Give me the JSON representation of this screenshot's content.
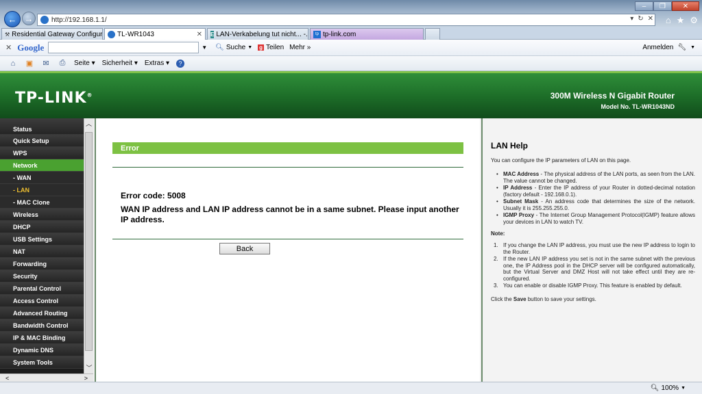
{
  "browser": {
    "address": "http://192.168.1.1/",
    "tabs": [
      {
        "label": "Residential Gateway Configura...",
        "active": false
      },
      {
        "label": "TL-WR1043",
        "active": true
      },
      {
        "label": "LAN-Verkabelung tut nicht... -...",
        "active": false
      },
      {
        "label": "tp-link.com",
        "active": false
      }
    ],
    "google_logo": "Google",
    "google_items": {
      "search": "Suche",
      "translate": "Teilen",
      "more": "Mehr »",
      "signin": "Anmelden"
    },
    "command_items": {
      "page": "Seite",
      "safety": "Sicherheit",
      "tools": "Extras"
    },
    "zoom": "100%"
  },
  "router": {
    "logo": "TP-LINK",
    "product": "300M Wireless N Gigabit Router",
    "model": "Model No. TL-WR1043ND",
    "menu": [
      {
        "label": "Status"
      },
      {
        "label": "Quick Setup"
      },
      {
        "label": "WPS"
      },
      {
        "label": "Network"
      },
      {
        "label": "- WAN"
      },
      {
        "label": "- LAN"
      },
      {
        "label": "- MAC Clone"
      },
      {
        "label": "Wireless"
      },
      {
        "label": "DHCP"
      },
      {
        "label": "USB Settings"
      },
      {
        "label": "NAT"
      },
      {
        "label": "Forwarding"
      },
      {
        "label": "Security"
      },
      {
        "label": "Parental Control"
      },
      {
        "label": "Access Control"
      },
      {
        "label": "Advanced Routing"
      },
      {
        "label": "Bandwidth Control"
      },
      {
        "label": "IP & MAC Binding"
      },
      {
        "label": "Dynamic DNS"
      },
      {
        "label": "System Tools"
      }
    ],
    "error": {
      "title": "Error",
      "code": "Error code: 5008",
      "message": "WAN IP address and LAN IP address cannot be in a same subnet. Please input another IP address.",
      "back_label": "Back"
    },
    "help": {
      "title": "LAN Help",
      "intro": "You can configure the IP parameters of LAN on this page.",
      "items": [
        {
          "term": "MAC Address",
          "text": " - The physical address of the LAN ports, as seen from the LAN. The value cannot be changed."
        },
        {
          "term": "IP Address",
          "text": " - Enter the IP address of your Router in dotted-decimal notation (factory default - 192.168.0.1)."
        },
        {
          "term": "Subnet Mask",
          "text": " - An address code that determines the size of the network. Usually it is 255.255.255.0."
        },
        {
          "term": "IGMP Proxy",
          "text": " - The Internet Group Management Protocol(IGMP) feature allows your devices in LAN to watch TV."
        }
      ],
      "note_label": "Note:",
      "notes": [
        "If you change the LAN IP address, you must use the new IP address to login to the Router.",
        "If the new LAN IP address you set is not in the same subnet with the previous one, the IP Address pool in the DHCP server will be configured automatically, but the Virtual Server and DMZ Host will not take effect until they are re-configured.",
        "You can enable or disable IGMP Proxy. This feature is enabled by default."
      ],
      "footer_pre": "Click the ",
      "footer_bold": "Save",
      "footer_post": " button to save your settings."
    }
  },
  "colors": {
    "accent_green": "#7dc143",
    "header_green": "#1c6b27",
    "menu_active": "#4aa130",
    "submenu_active": "#f0c030"
  }
}
